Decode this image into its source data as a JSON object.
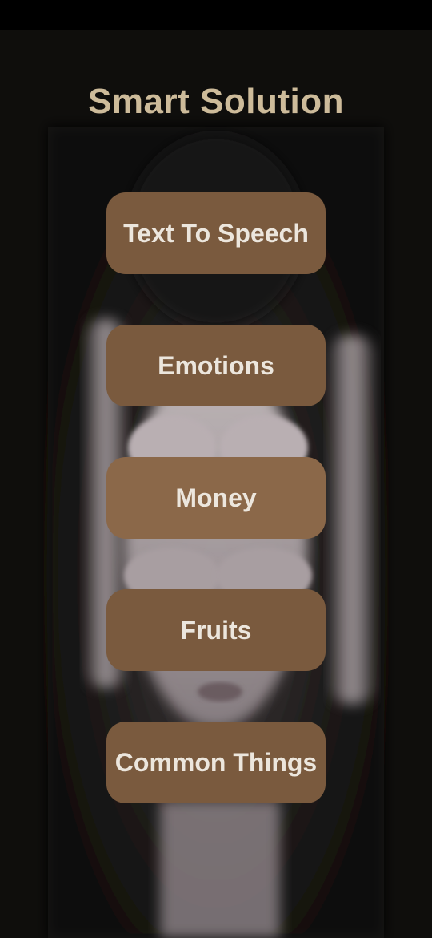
{
  "app": {
    "title": "Smart Solution"
  },
  "menu": {
    "items": [
      {
        "label": "Text To Speech"
      },
      {
        "label": "Emotions"
      },
      {
        "label": "Money"
      },
      {
        "label": "Fruits"
      },
      {
        "label": "Common Things"
      }
    ]
  },
  "colors": {
    "title": "#cdbb9a",
    "button_bg": "#7a5a3e",
    "button_text": "#ece6dd",
    "background": "#0f0e0c",
    "status_bar": "#000000"
  },
  "background_image": {
    "description_icon": "person-covering-eyes-photo"
  }
}
